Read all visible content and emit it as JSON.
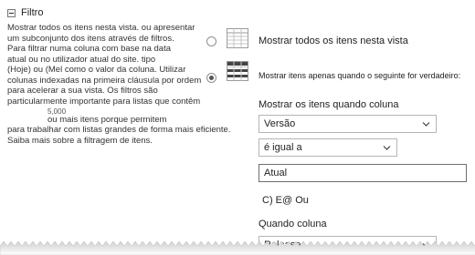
{
  "section": {
    "title": "Filtro"
  },
  "description": {
    "lines": [
      "Mostrar todos os itens nesta vista. ou apresentar",
      "um subconjunto dos itens através de filtros.",
      "Para filtrar numa coluna com base na data",
      "atual ou no utilizador atual do site. tipo",
      "(Hoje) ou (Mel como o valor da coluna. Utilizar",
      "colunas indexadas na primeira cláusula por ordem",
      "para acelerar a sua vista. Os filtros são",
      "particularmente importante para listas que contêm",
      "ou mais itens porque permitem",
      "para trabalhar com listas grandes de forma mais eficiente.",
      "Saiba mais sobre a filtragem de itens."
    ],
    "number": "5,000"
  },
  "options": {
    "show_all_label": "Mostrar todos os itens nesta vista",
    "show_filtered_label": "Mostrar itens apenas quando o seguinte for verdadeiro:",
    "selected": "show_filtered"
  },
  "filter": {
    "column_label": "Mostrar os itens quando coluna",
    "column_value": "Versão",
    "operator_value": "é igual a",
    "value_input": "Atual",
    "andor_text": "C) E@ Ou",
    "second_column_label": "Quando coluna",
    "second_column_value": "Release"
  },
  "icons": {
    "collapse": "minus-box-icon",
    "show_all": "table-grid-icon",
    "show_filtered": "filtered-table-icon",
    "dropdown": "chevron-down-icon"
  }
}
